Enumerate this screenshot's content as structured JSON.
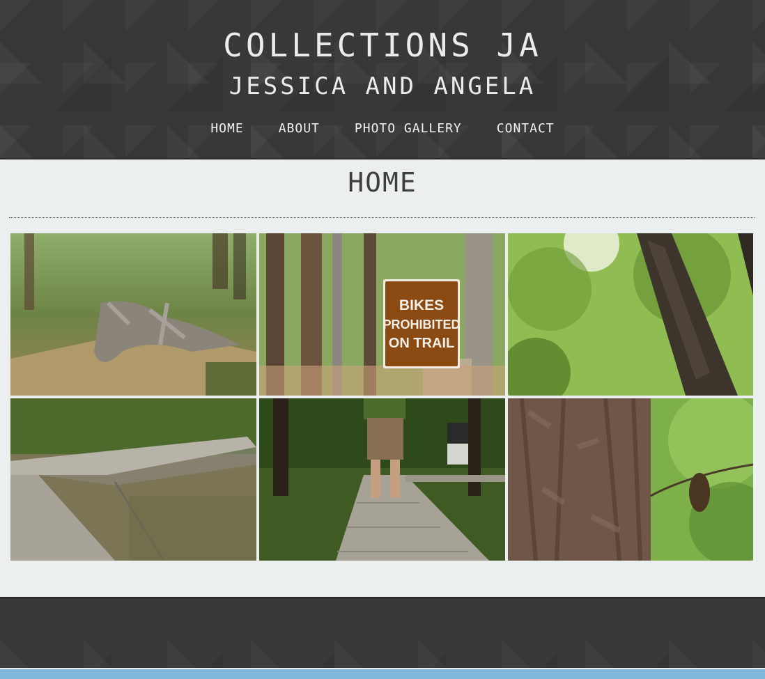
{
  "header": {
    "title": "COLLECTIONS JA",
    "subtitle": "JESSICA AND ANGELA"
  },
  "nav": {
    "items": [
      {
        "label": "HOME"
      },
      {
        "label": "ABOUT"
      },
      {
        "label": "PHOTO GALLERY"
      },
      {
        "label": "CONTACT"
      }
    ]
  },
  "main": {
    "heading": "HOME",
    "sign_text": [
      "BIKES",
      "PROHIBITED",
      "ON TRAIL"
    ]
  },
  "colors": {
    "header_bg": "#383838",
    "page_bg": "#eceff0",
    "accent_bar": "#7fb6dc",
    "sign_bg": "#8a4a12"
  }
}
